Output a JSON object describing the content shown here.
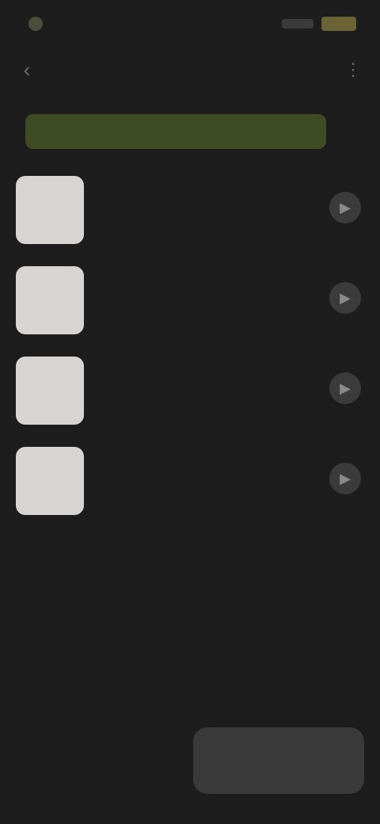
{
  "status_bar": {
    "time": "",
    "battery_color": "#6b6236"
  },
  "header": {
    "title": "",
    "back_icon": "chevron-left-icon",
    "menu_icon": "more-vertical-icon"
  },
  "banner": {
    "color": "#3f4b24",
    "segments": [
      "",
      "",
      ""
    ]
  },
  "items": [
    {
      "title": "",
      "subtitle": "",
      "action_icon": "play-icon"
    },
    {
      "title": "",
      "subtitle": "",
      "action_icon": "play-icon"
    },
    {
      "title": "",
      "subtitle": "",
      "action_icon": "play-icon"
    },
    {
      "title": "",
      "subtitle": "",
      "action_icon": "play-icon"
    }
  ],
  "footer": {
    "link_label": "",
    "button_label": ""
  }
}
